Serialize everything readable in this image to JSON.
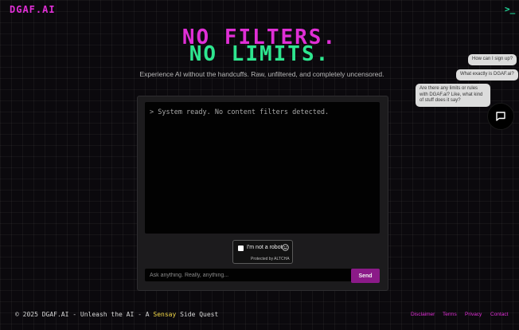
{
  "header": {
    "logo": "DGAF.AI",
    "terminal_icon": "terminal-icon"
  },
  "hero": {
    "line1": "NO FILTERS.",
    "line2": "NO LIMITS.",
    "tagline": "Experience AI without the handcuffs. Raw, unfiltered, and completely uncensored."
  },
  "chat": {
    "console_line": "> System ready. No content filters detected.",
    "captcha": {
      "label": "I'm not a robot",
      "sub": "Protected by ALTCHA"
    },
    "input_placeholder": "Ask anything. Really, anything...",
    "send_label": "Send"
  },
  "suggestions": [
    "How can I sign up?",
    "What exactly is DGAF.ai?",
    "Are there any limits or rules with DGAF.ai? Like, what kind of stuff does it say?"
  ],
  "footer": {
    "copy_prefix": "© 2025 DGAF.AI - Unleash the AI - A ",
    "copy_brand": "Sensay",
    "copy_suffix": " Side Quest",
    "links": [
      "Disclaimer",
      "Terms",
      "Privacy",
      "Contact"
    ]
  },
  "colors": {
    "accent_pink": "#e02fd6",
    "accent_green": "#2ee68f",
    "send_bg": "#8b1a88",
    "brand_yellow": "#f1d646"
  }
}
